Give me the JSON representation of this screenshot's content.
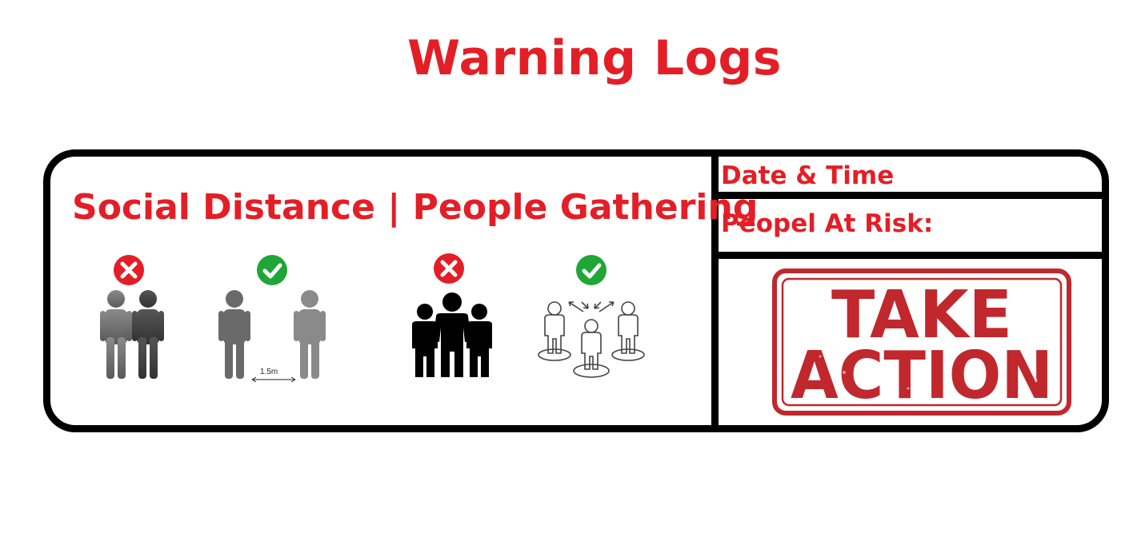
{
  "page": {
    "title": "Warning Logs"
  },
  "panel": {
    "heading": "Social Distance | People Gathering",
    "icons": [
      {
        "name": "people-close-together",
        "status": "bad",
        "status_icon": "x-circle-icon"
      },
      {
        "name": "people-distanced",
        "status": "good",
        "status_icon": "check-circle-icon",
        "distance_label": "1.5m"
      },
      {
        "name": "crowd-gathering",
        "status": "bad",
        "status_icon": "x-circle-icon"
      },
      {
        "name": "people-dispersed",
        "status": "good",
        "status_icon": "check-circle-icon"
      }
    ],
    "info": {
      "date_label": "Date & Time",
      "risk_label": "Peopel At Risk:"
    },
    "stamp": {
      "line1": "TAKE",
      "line2": "ACTION"
    }
  },
  "colors": {
    "accent_red": "#e41e26",
    "success_green": "#1fa637",
    "stamp_red": "#c0282d",
    "border": "#000000"
  }
}
